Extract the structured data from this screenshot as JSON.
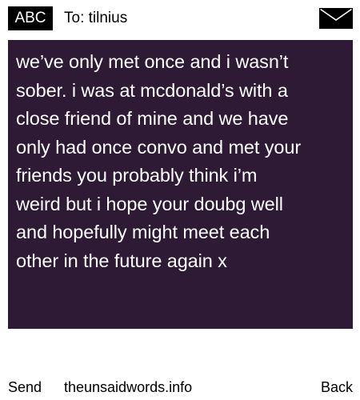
{
  "header": {
    "badge_label": "ABC",
    "to_label": "To: tilnius",
    "icon": "envelope-icon"
  },
  "message": {
    "lines": [
      "we’ve only met once and i wasn’t",
      "sober. i was at mcdonald’s with a",
      "close friend of mine and we have",
      "only had once convo and met your",
      "friends you probably think i’m",
      "weird but i hope your doubg well",
      "and hopefully might meet each",
      "other in the future again x"
    ]
  },
  "footer": {
    "send_label": "Send",
    "site_label": "theunsaidwords.info",
    "back_label": "Back"
  },
  "colors": {
    "message_background": "#2e1a35",
    "message_text": "#ffffff",
    "badge_background": "#000000",
    "page_background": "#ffffff"
  }
}
